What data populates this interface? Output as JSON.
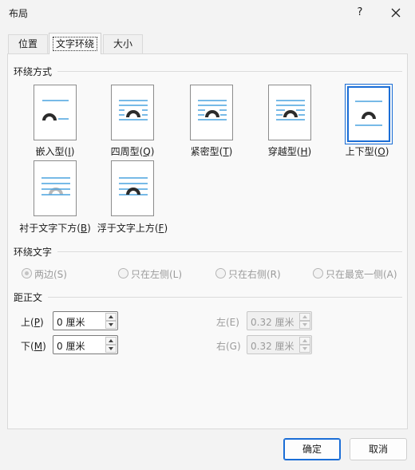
{
  "window": {
    "title": "布局",
    "help_glyph": "?"
  },
  "tabs": [
    {
      "label": "位置",
      "active": false
    },
    {
      "label": "文字环绕",
      "active": true
    },
    {
      "label": "大小",
      "active": false
    }
  ],
  "wrap_section": {
    "title": "环绕方式",
    "options": [
      {
        "label": "嵌入型",
        "key": "I",
        "selected": false
      },
      {
        "label": "四周型",
        "key": "Q",
        "selected": false
      },
      {
        "label": "紧密型",
        "key": "T",
        "selected": false
      },
      {
        "label": "穿越型",
        "key": "H",
        "selected": false
      },
      {
        "label": "上下型",
        "key": "O",
        "selected": true
      },
      {
        "label": "衬于文字下方",
        "key": "B",
        "selected": false
      },
      {
        "label": "浮于文字上方",
        "key": "F",
        "selected": false
      }
    ]
  },
  "wrap_text": {
    "title": "环绕文字",
    "options": [
      {
        "label": "两边(S)",
        "checked": true
      },
      {
        "label": "只在左侧(L)",
        "checked": false
      },
      {
        "label": "只在右侧(R)",
        "checked": false
      },
      {
        "label": "只在最宽一侧(A)",
        "checked": false
      }
    ]
  },
  "distance": {
    "title": "距正文",
    "top": {
      "label": "上",
      "key": "P",
      "value": "0 厘米"
    },
    "bottom": {
      "label": "下",
      "key": "M",
      "value": "0 厘米"
    },
    "left": {
      "label": "左(E)",
      "value": "0.32 厘米"
    },
    "right": {
      "label": "右(G)",
      "value": "0.32 厘米"
    }
  },
  "buttons": {
    "ok": "确定",
    "cancel": "取消"
  },
  "colors": {
    "accent": "#1a6dd6",
    "icon_line": "#4aa3df",
    "icon_shape": "#2b2b2b"
  }
}
